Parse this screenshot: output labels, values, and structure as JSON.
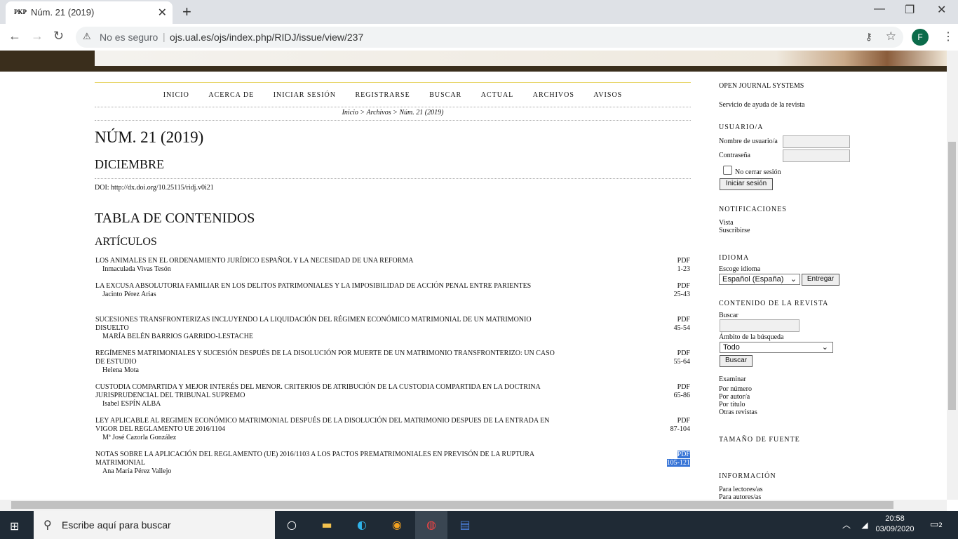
{
  "browser": {
    "tab_title": "Núm. 21 (2019)",
    "tab_favicon": "PKP",
    "security": "No es seguro",
    "url": "ojs.ual.es/ojs/index.php/RIDJ/issue/view/237",
    "profile_initial": "F"
  },
  "site": {
    "menu": [
      "INICIO",
      "ACERCA DE",
      "INICIAR SESIÓN",
      "REGISTRARSE",
      "BUSCAR",
      "ACTUAL",
      "ARCHIVOS",
      "AVISOS"
    ],
    "breadcrumb": "Inicio > Archivos > Núm. 21 (2019)",
    "issue_title": "NÚM. 21 (2019)",
    "issue_subtitle": "DICIEMBRE",
    "doi": "DOI: http://dx.doi.org/10.25115/ridj.v0i21",
    "toc_title": "TABLA DE CONTENIDOS",
    "section_title": "ARTÍCULOS"
  },
  "articles": [
    {
      "title": "Los animales en el ordenamiento jurídico español y la necesidad de una reforma",
      "author": "Inmaculada Vivas Tesón",
      "galley": "PDF",
      "pages": "1-23"
    },
    {
      "title": "La excusa absolutoria familiar en los delitos patrimoniales y la imposibilidad de acción penal entre parientes",
      "author": "Jacinto Pérez Arias",
      "galley": "PDF",
      "pages": "25-43"
    },
    {
      "title": "Sucesiones transfronterizas incluyendo la liquidación del régimen económico matrimonial de un matrimonio disuelto",
      "author": "MARÍA BELÉN BARRIOS GARRIDO-LESTACHE",
      "galley": "PDF",
      "pages": "45-54"
    },
    {
      "title": "Regímenes matrimoniales y sucesión después de la disolución por muerte de un matrimonio transfronterizo: un caso de estudio",
      "author": "Helena Mota",
      "galley": "PDF",
      "pages": "55-64"
    },
    {
      "title": "Custodia compartida y mejor interés del menor. Criterios de atribución de la custodia compartida en la doctrina jurisprudencial del Tribunal Supremo",
      "author": "Isabel ESPÍN ALBA",
      "galley": "PDF",
      "pages": "65-86"
    },
    {
      "title": "Ley aplicable al regimen económico matrimonial después de la disolución del matrimonio despues de la entrada en vigor del reglamento UE 2016/1104",
      "author": "Mª José Cazorla González",
      "galley": "PDF",
      "pages": "87-104"
    },
    {
      "title": "Notas sobre la aplicación del Reglamento (UE) 2016/1103 a los pactos prematrimoniales en previsón de la ruptura matrimonial",
      "author": "Ana María Pérez Vallejo",
      "galley": "PDF",
      "pages": "105-121"
    }
  ],
  "sidebar": {
    "ojs": "OPEN JOURNAL SYSTEMS",
    "help": "Servicio de ayuda de la revista",
    "user_heading": "USUARIO/A",
    "username_label": "Nombre de usuario/a",
    "password_label": "Contraseña",
    "remember_label": "No cerrar sesión",
    "login_button": "Iniciar sesión",
    "notif_heading": "NOTIFICACIONES",
    "notif_view": "Vista",
    "notif_subscribe": "Suscribirse",
    "lang_heading": "IDIOMA",
    "lang_label": "Escoge idioma",
    "lang_value": "Español (España)",
    "lang_submit": "Entregar",
    "content_heading": "CONTENIDO DE LA REVISTA",
    "search_label": "Buscar",
    "scope_label": "Ámbito de la búsqueda",
    "scope_value": "Todo",
    "search_button": "Buscar",
    "browse_label": "Examinar",
    "browse_issue": "Por número",
    "browse_author": "Por autor/a",
    "browse_title": "Por título",
    "other_journals": "Otras revistas",
    "font_heading": "TAMAÑO DE FUENTE",
    "info_heading": "INFORMACIÓN",
    "info_readers": "Para lectores/as",
    "info_authors": "Para autores/as"
  },
  "taskbar": {
    "search_placeholder": "Escribe aquí para buscar",
    "time": "20:58",
    "date": "03/09/2020",
    "notifications": "2"
  }
}
